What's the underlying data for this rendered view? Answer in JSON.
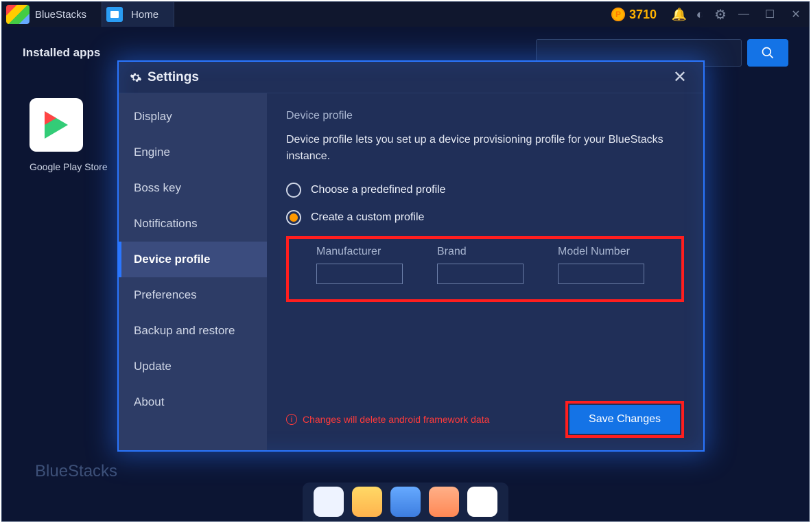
{
  "titlebar": {
    "app_name": "BlueStacks",
    "home_tab": "Home",
    "points": "3710"
  },
  "topbar": {
    "installed_apps": "Installed apps"
  },
  "apps": {
    "play_store": "Google Play Store"
  },
  "footer": {
    "brand": "BlueStacks"
  },
  "modal": {
    "title": "Settings",
    "close": "✕",
    "sidebar": [
      "Display",
      "Engine",
      "Boss key",
      "Notifications",
      "Device profile",
      "Preferences",
      "Backup and restore",
      "Update",
      "About"
    ],
    "active_index": 4,
    "content": {
      "heading": "Device profile",
      "description": "Device profile lets you set up a device provisioning profile for your BlueStacks instance.",
      "option_predefined": "Choose a predefined profile",
      "option_custom": "Create a custom profile",
      "fields": {
        "manufacturer": {
          "label": "Manufacturer",
          "value": ""
        },
        "brand": {
          "label": "Brand",
          "value": ""
        },
        "model": {
          "label": "Model Number",
          "value": ""
        }
      },
      "warning": "Changes will delete android framework data",
      "save": "Save Changes"
    }
  }
}
